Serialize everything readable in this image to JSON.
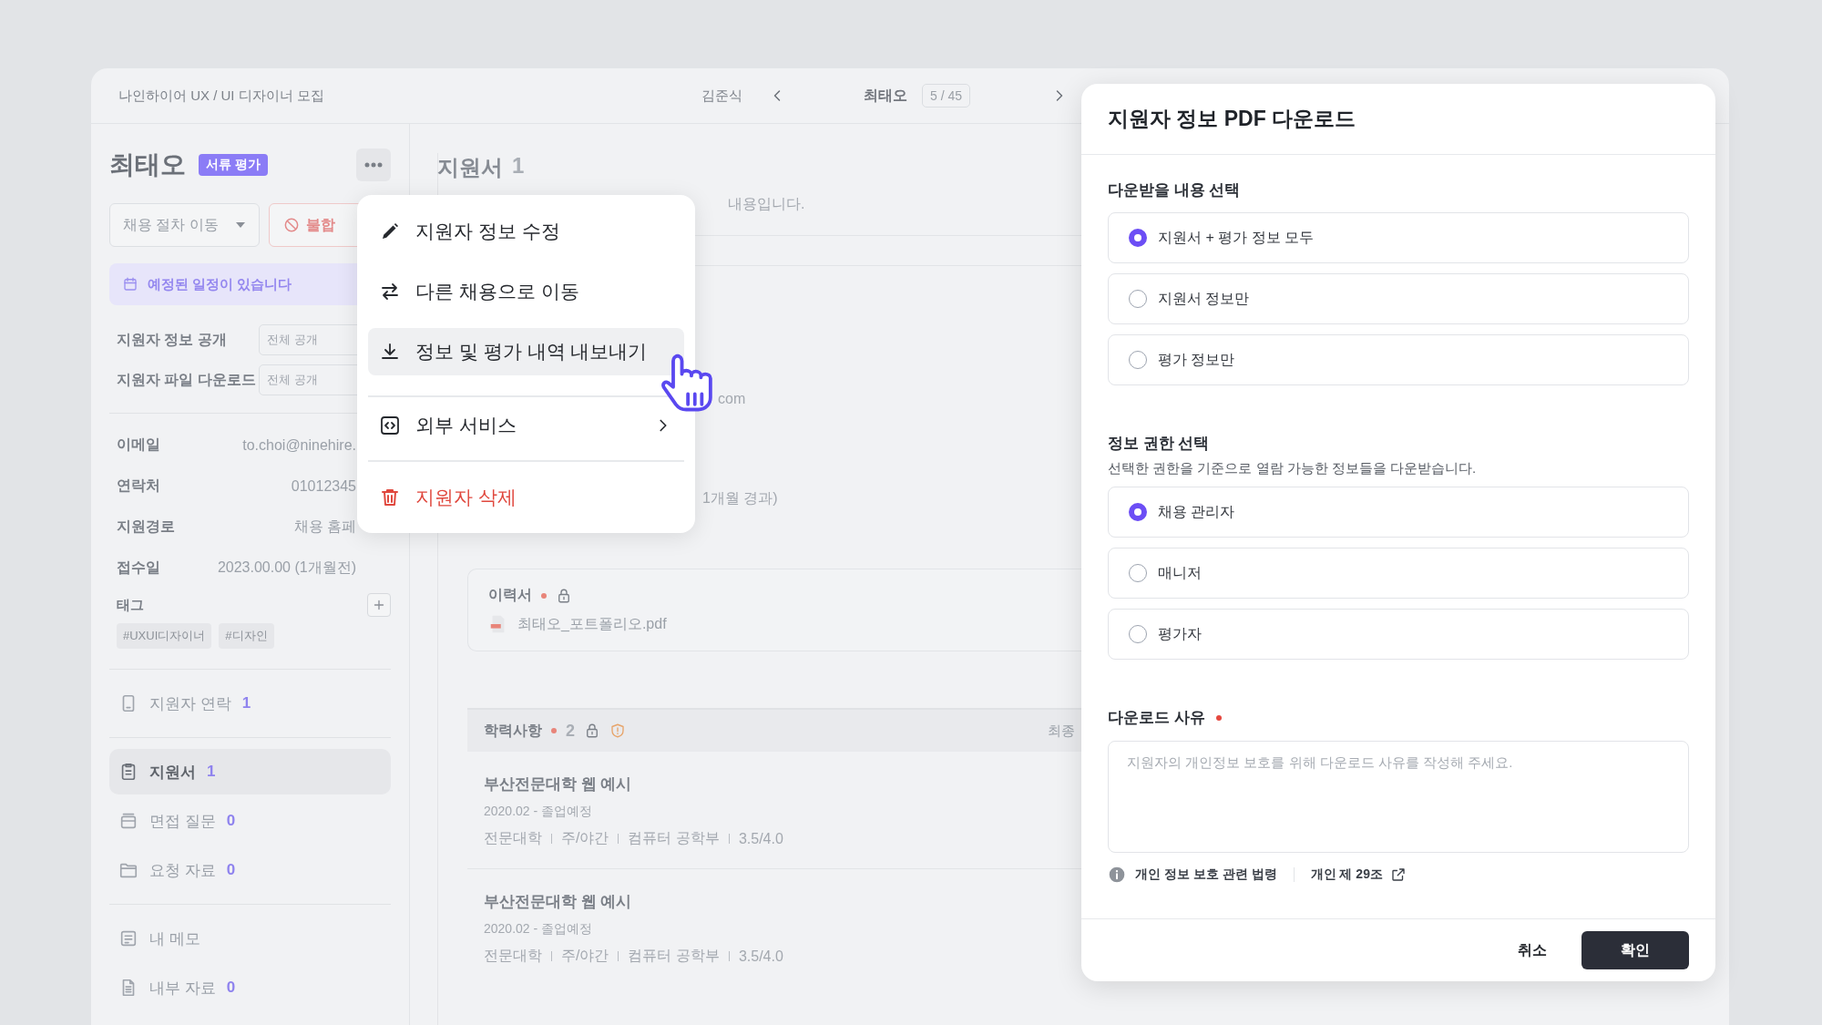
{
  "header": {
    "breadcrumb": "나인하이어 UX / UI 디자이너 모집",
    "prev_applicant": "김준식",
    "current_applicant": "최태오",
    "position": "5 / 45"
  },
  "applicant": {
    "name": "최태오",
    "stage_badge": "서류 평가",
    "stage_select": "채용 절차 이동",
    "reject_button": "불합",
    "schedule_notice": "예정된 일정이 있습니다",
    "settings": [
      {
        "label": "지원자 정보 공개",
        "value": "전체 공개"
      },
      {
        "label": "지원자 파일 다운로드",
        "value": "전체 공개"
      }
    ],
    "info": [
      {
        "label": "이메일",
        "value": "to.choi@ninehire."
      },
      {
        "label": "연락처",
        "value": "01012345"
      },
      {
        "label": "지원경로",
        "value": "채용 홈페"
      },
      {
        "label": "접수일",
        "value": "2023.00.00 (1개월전)"
      }
    ],
    "tags_label": "태그",
    "tags": [
      "#UXUI디자이너",
      "#디자인"
    ]
  },
  "sidebar": {
    "groups": [
      [
        {
          "label": "지원자 연락",
          "count": "1",
          "selected": false
        }
      ],
      [
        {
          "label": "지원서",
          "count": "1",
          "selected": true
        },
        {
          "label": "면접 질문",
          "count": "0",
          "selected": false
        },
        {
          "label": "요청 자료",
          "count": "0",
          "selected": false
        }
      ],
      [
        {
          "label": "내 메모",
          "selected": false
        },
        {
          "label": "내부 자료",
          "count": "0",
          "selected": false
        }
      ]
    ]
  },
  "content": {
    "title": "지원서",
    "count": "1",
    "description_fragment": "내용입니다.",
    "email_fragment": "com",
    "date_fragment": "1개월 경과)",
    "resume": {
      "label": "이력서",
      "required": true,
      "file": "최태오_포트폴리오.pdf"
    },
    "education": {
      "title": "학력사항",
      "required": true,
      "count": "2",
      "column_2": "최종",
      "items": [
        {
          "school": "부산전문대학 웹 예시",
          "period": "2020.02 - 졸업예정",
          "details": [
            "전문대학",
            "주/야간",
            "컴퓨터 공학부",
            "3.5/4.0"
          ]
        },
        {
          "school": "부산전문대학 웹 예시",
          "period": "2020.02 - 졸업예정",
          "details": [
            "전문대학",
            "주/야간",
            "컴퓨터 공학부",
            "3.5/4.0"
          ]
        }
      ]
    }
  },
  "context_menu": {
    "groups": [
      [
        {
          "kind": "action",
          "label": "지원자 정보 수정",
          "highlighted": false
        },
        {
          "kind": "action",
          "label": "다른 채용으로 이동",
          "highlighted": false
        },
        {
          "kind": "action",
          "label": "정보 및 평가 내역 내보내기",
          "highlighted": true
        }
      ],
      [
        {
          "kind": "submenu",
          "label": "외부 서비스",
          "highlighted": false
        }
      ],
      [
        {
          "kind": "danger",
          "label": "지원자 삭제",
          "highlighted": false
        }
      ]
    ]
  },
  "dialog": {
    "title": "지원자 정보 PDF 다운로드",
    "content_section": {
      "title": "다운받을 내용 선택",
      "options": [
        {
          "label": "지원서 + 평가 정보 모두",
          "selected": true
        },
        {
          "label": "지원서 정보만",
          "selected": false
        },
        {
          "label": "평가 정보만",
          "selected": false
        }
      ]
    },
    "permission_section": {
      "title": "정보 권한 선택",
      "description": "선택한 권한을 기준으로 열람 가능한 정보들을 다운받습니다.",
      "options": [
        {
          "label": "채용 관리자",
          "selected": true
        },
        {
          "label": "매니저",
          "selected": false
        },
        {
          "label": "평가자",
          "selected": false
        }
      ]
    },
    "reason": {
      "label": "다운로드 사유",
      "required": true,
      "placeholder": "지원자의 개인정보 보호를 위해 다운로드 사유를 작성해 주세요."
    },
    "legal_note": "개인 정보 보호 관련 법령",
    "legal_link": "개인 제 29조",
    "buttons": [
      {
        "kind": "secondary",
        "label": "취소"
      },
      {
        "kind": "primary",
        "label": "확인"
      }
    ]
  }
}
